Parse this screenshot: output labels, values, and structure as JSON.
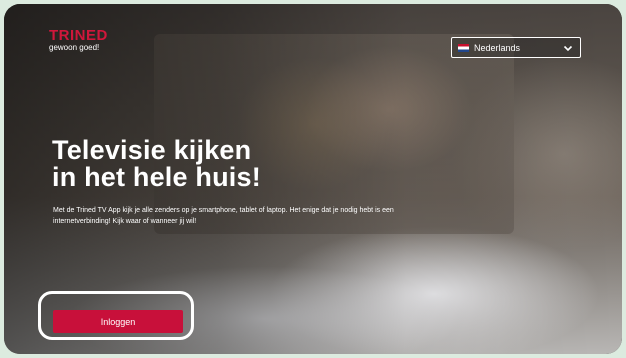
{
  "brand": {
    "name": "TRINED",
    "tagline": "gewoon goed!",
    "color": "#d0173b"
  },
  "language_selector": {
    "selected": "Nederlands",
    "flag_icon": "netherlands-flag-icon",
    "dropdown_icon": "chevron-down-icon"
  },
  "hero": {
    "headline_line1": "Televisie kijken",
    "headline_line2": "in het hele huis!",
    "body": "Met de Trined TV App kijk je alle zenders op je smartphone, tablet of laptop. Het enige dat je nodig hebt is een internetverbinding! Kijk waar of wanneer jij wil!"
  },
  "actions": {
    "login_label": "Inloggen",
    "login_color": "#c8103a"
  }
}
